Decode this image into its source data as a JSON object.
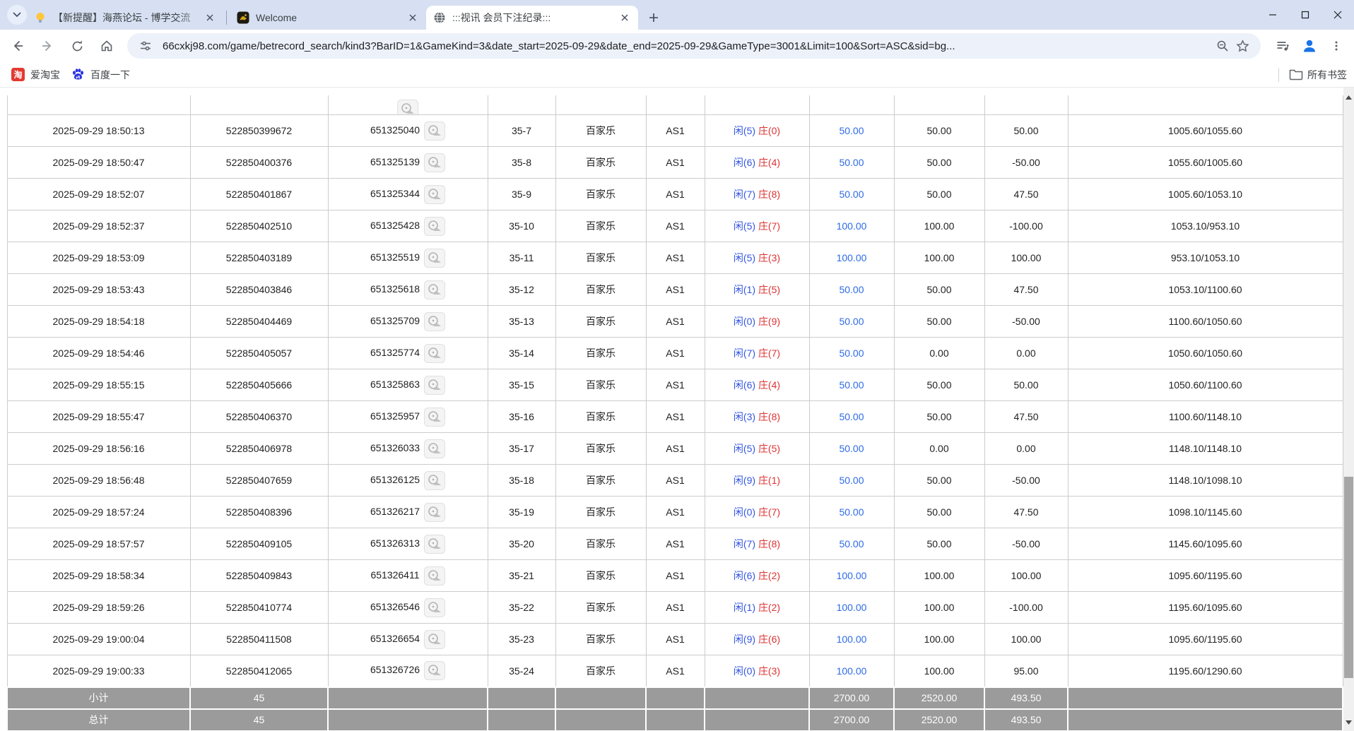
{
  "browser": {
    "tabs": [
      {
        "title": "【新提醒】海燕论坛 - 博学交流",
        "favicon": "lightbulb-icon",
        "active": false
      },
      {
        "title": "Welcome",
        "favicon": "gold-crest-icon",
        "active": false
      },
      {
        "title": ":::视讯 会员下注纪录:::",
        "favicon": "globe-icon",
        "active": true
      }
    ],
    "url": "66cxkj98.com/game/betrecord_search/kind3?BarID=1&GameKind=3&date_start=2025-09-29&date_end=2025-09-29&GameType=3001&Limit=100&Sort=ASC&sid=bg...",
    "bookmarks": [
      {
        "label": "爱淘宝",
        "icon": "taobao-icon"
      },
      {
        "label": "百度一下",
        "icon": "baidu-paw-icon"
      }
    ],
    "all_bookmarks_label": "所有书签"
  },
  "table": {
    "rows": [
      {
        "time": "2025-09-29 18:50:13",
        "bet_id": "522850399672",
        "account": "651325040",
        "round": "35-7",
        "game": "百家乐",
        "table": "AS1",
        "bet_player": "闲(5)",
        "bet_banker": "庄(0)",
        "amount": "50.00",
        "valid": "50.00",
        "winloss": "50.00",
        "balance": "1005.60/1055.60"
      },
      {
        "time": "2025-09-29 18:50:47",
        "bet_id": "522850400376",
        "account": "651325139",
        "round": "35-8",
        "game": "百家乐",
        "table": "AS1",
        "bet_player": "闲(6)",
        "bet_banker": "庄(4)",
        "amount": "50.00",
        "valid": "50.00",
        "winloss": "-50.00",
        "balance": "1055.60/1005.60"
      },
      {
        "time": "2025-09-29 18:52:07",
        "bet_id": "522850401867",
        "account": "651325344",
        "round": "35-9",
        "game": "百家乐",
        "table": "AS1",
        "bet_player": "闲(7)",
        "bet_banker": "庄(8)",
        "amount": "50.00",
        "valid": "50.00",
        "winloss": "47.50",
        "balance": "1005.60/1053.10"
      },
      {
        "time": "2025-09-29 18:52:37",
        "bet_id": "522850402510",
        "account": "651325428",
        "round": "35-10",
        "game": "百家乐",
        "table": "AS1",
        "bet_player": "闲(5)",
        "bet_banker": "庄(7)",
        "amount": "100.00",
        "valid": "100.00",
        "winloss": "-100.00",
        "balance": "1053.10/953.10"
      },
      {
        "time": "2025-09-29 18:53:09",
        "bet_id": "522850403189",
        "account": "651325519",
        "round": "35-11",
        "game": "百家乐",
        "table": "AS1",
        "bet_player": "闲(5)",
        "bet_banker": "庄(3)",
        "amount": "100.00",
        "valid": "100.00",
        "winloss": "100.00",
        "balance": "953.10/1053.10"
      },
      {
        "time": "2025-09-29 18:53:43",
        "bet_id": "522850403846",
        "account": "651325618",
        "round": "35-12",
        "game": "百家乐",
        "table": "AS1",
        "bet_player": "闲(1)",
        "bet_banker": "庄(5)",
        "amount": "50.00",
        "valid": "50.00",
        "winloss": "47.50",
        "balance": "1053.10/1100.60"
      },
      {
        "time": "2025-09-29 18:54:18",
        "bet_id": "522850404469",
        "account": "651325709",
        "round": "35-13",
        "game": "百家乐",
        "table": "AS1",
        "bet_player": "闲(0)",
        "bet_banker": "庄(9)",
        "amount": "50.00",
        "valid": "50.00",
        "winloss": "-50.00",
        "balance": "1100.60/1050.60"
      },
      {
        "time": "2025-09-29 18:54:46",
        "bet_id": "522850405057",
        "account": "651325774",
        "round": "35-14",
        "game": "百家乐",
        "table": "AS1",
        "bet_player": "闲(7)",
        "bet_banker": "庄(7)",
        "amount": "50.00",
        "valid": "0.00",
        "winloss": "0.00",
        "balance": "1050.60/1050.60"
      },
      {
        "time": "2025-09-29 18:55:15",
        "bet_id": "522850405666",
        "account": "651325863",
        "round": "35-15",
        "game": "百家乐",
        "table": "AS1",
        "bet_player": "闲(6)",
        "bet_banker": "庄(4)",
        "amount": "50.00",
        "valid": "50.00",
        "winloss": "50.00",
        "balance": "1050.60/1100.60"
      },
      {
        "time": "2025-09-29 18:55:47",
        "bet_id": "522850406370",
        "account": "651325957",
        "round": "35-16",
        "game": "百家乐",
        "table": "AS1",
        "bet_player": "闲(3)",
        "bet_banker": "庄(8)",
        "amount": "50.00",
        "valid": "50.00",
        "winloss": "47.50",
        "balance": "1100.60/1148.10"
      },
      {
        "time": "2025-09-29 18:56:16",
        "bet_id": "522850406978",
        "account": "651326033",
        "round": "35-17",
        "game": "百家乐",
        "table": "AS1",
        "bet_player": "闲(5)",
        "bet_banker": "庄(5)",
        "amount": "50.00",
        "valid": "0.00",
        "winloss": "0.00",
        "balance": "1148.10/1148.10"
      },
      {
        "time": "2025-09-29 18:56:48",
        "bet_id": "522850407659",
        "account": "651326125",
        "round": "35-18",
        "game": "百家乐",
        "table": "AS1",
        "bet_player": "闲(9)",
        "bet_banker": "庄(1)",
        "amount": "50.00",
        "valid": "50.00",
        "winloss": "-50.00",
        "balance": "1148.10/1098.10"
      },
      {
        "time": "2025-09-29 18:57:24",
        "bet_id": "522850408396",
        "account": "651326217",
        "round": "35-19",
        "game": "百家乐",
        "table": "AS1",
        "bet_player": "闲(0)",
        "bet_banker": "庄(7)",
        "amount": "50.00",
        "valid": "50.00",
        "winloss": "47.50",
        "balance": "1098.10/1145.60"
      },
      {
        "time": "2025-09-29 18:57:57",
        "bet_id": "522850409105",
        "account": "651326313",
        "round": "35-20",
        "game": "百家乐",
        "table": "AS1",
        "bet_player": "闲(7)",
        "bet_banker": "庄(8)",
        "amount": "50.00",
        "valid": "50.00",
        "winloss": "-50.00",
        "balance": "1145.60/1095.60"
      },
      {
        "time": "2025-09-29 18:58:34",
        "bet_id": "522850409843",
        "account": "651326411",
        "round": "35-21",
        "game": "百家乐",
        "table": "AS1",
        "bet_player": "闲(6)",
        "bet_banker": "庄(2)",
        "amount": "100.00",
        "valid": "100.00",
        "winloss": "100.00",
        "balance": "1095.60/1195.60"
      },
      {
        "time": "2025-09-29 18:59:26",
        "bet_id": "522850410774",
        "account": "651326546",
        "round": "35-22",
        "game": "百家乐",
        "table": "AS1",
        "bet_player": "闲(1)",
        "bet_banker": "庄(2)",
        "amount": "100.00",
        "valid": "100.00",
        "winloss": "-100.00",
        "balance": "1195.60/1095.60"
      },
      {
        "time": "2025-09-29 19:00:04",
        "bet_id": "522850411508",
        "account": "651326654",
        "round": "35-23",
        "game": "百家乐",
        "table": "AS1",
        "bet_player": "闲(9)",
        "bet_banker": "庄(6)",
        "amount": "100.00",
        "valid": "100.00",
        "winloss": "100.00",
        "balance": "1095.60/1195.60"
      },
      {
        "time": "2025-09-29 19:00:33",
        "bet_id": "522850412065",
        "account": "651326726",
        "round": "35-24",
        "game": "百家乐",
        "table": "AS1",
        "bet_player": "闲(0)",
        "bet_banker": "庄(3)",
        "amount": "100.00",
        "valid": "100.00",
        "winloss": "95.00",
        "balance": "1195.60/1290.60"
      }
    ],
    "subtotal": {
      "label": "小计",
      "count": "45",
      "amount": "2700.00",
      "valid": "2520.00",
      "winloss": "493.50"
    },
    "total": {
      "label": "总计",
      "count": "45",
      "amount": "2700.00",
      "valid": "2520.00",
      "winloss": "493.50"
    }
  },
  "colors": {
    "link_blue": "#2e6be5",
    "player_blue": "#3355e0",
    "banker_red": "#dd3333",
    "negative_red": "#e63333",
    "summary_bg": "#9b9b9b",
    "tabstrip_bg": "#d6e0f2"
  }
}
